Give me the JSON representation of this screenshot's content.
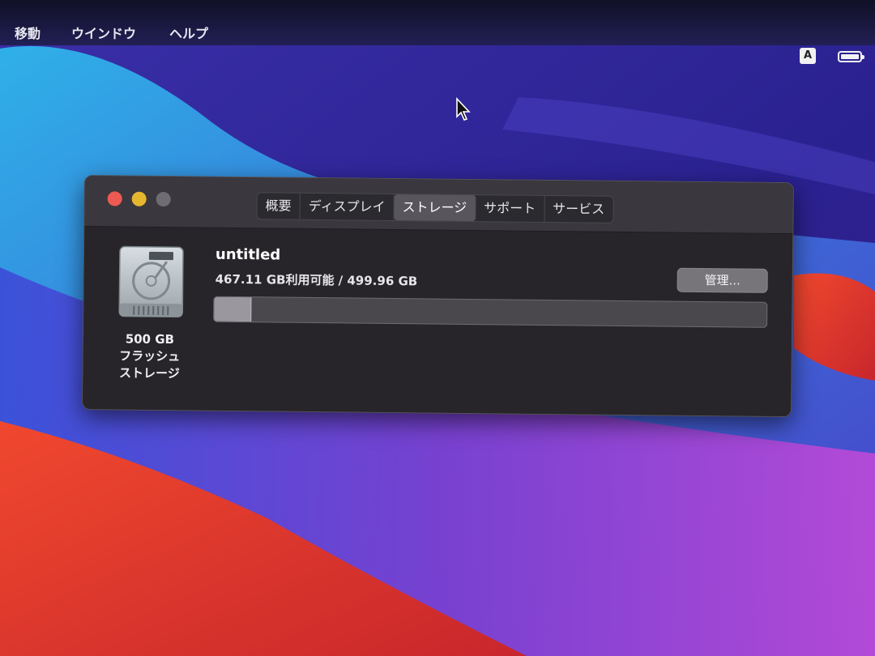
{
  "menubar": {
    "items": [
      "移動",
      "ウインドウ",
      "ヘルプ"
    ],
    "input_source": "A",
    "battery_icon": "battery-icon"
  },
  "window": {
    "tabs": [
      "概要",
      "ディスプレイ",
      "ストレージ",
      "サポート",
      "サービス"
    ],
    "active_tab": "ストレージ",
    "storage": {
      "disk_icon": "hard-drive-icon",
      "disk_label_lines": [
        "500 GB",
        "フラッシュ",
        "ストレージ"
      ],
      "volume_name": "untitled",
      "capacity_text": "467.11 GB利用可能 / 499.96 GB",
      "available_gb": 467.11,
      "total_gb": 499.96,
      "used_fraction": 0.066,
      "manage_button_label": "管理..."
    }
  },
  "colors": {
    "close": "#ec5a51",
    "minimize": "#e7b62f",
    "zoom_inactive": "#6f6d72",
    "window_bg": "#2b2930"
  }
}
